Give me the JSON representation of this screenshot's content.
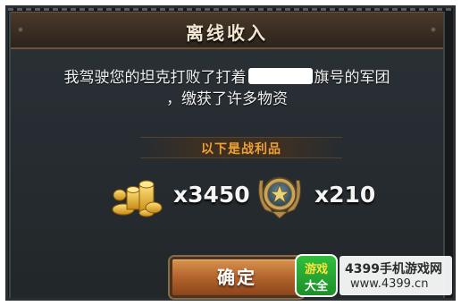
{
  "dialog": {
    "title": "离线收入",
    "message_line1_before": "我驾驶您的坦克打败了打着",
    "message_line1_after": "旗号的军团",
    "message_line2": "，缴获了许多物资",
    "loot_heading": "以下是战利品",
    "rewards": [
      {
        "icon": "gold-coins-icon",
        "amount": "x3450"
      },
      {
        "icon": "star-medal-icon",
        "amount": "x210"
      }
    ],
    "confirm_label": "确定"
  },
  "watermark": {
    "badge_top": "游戏",
    "badge_bottom": "大全",
    "line1": "4399手机游戏网",
    "line2": "www.4399.cn"
  },
  "colors": {
    "loot_heading": "#f0a030",
    "button": "#b3642c",
    "title_bar": "#3a2d22"
  }
}
